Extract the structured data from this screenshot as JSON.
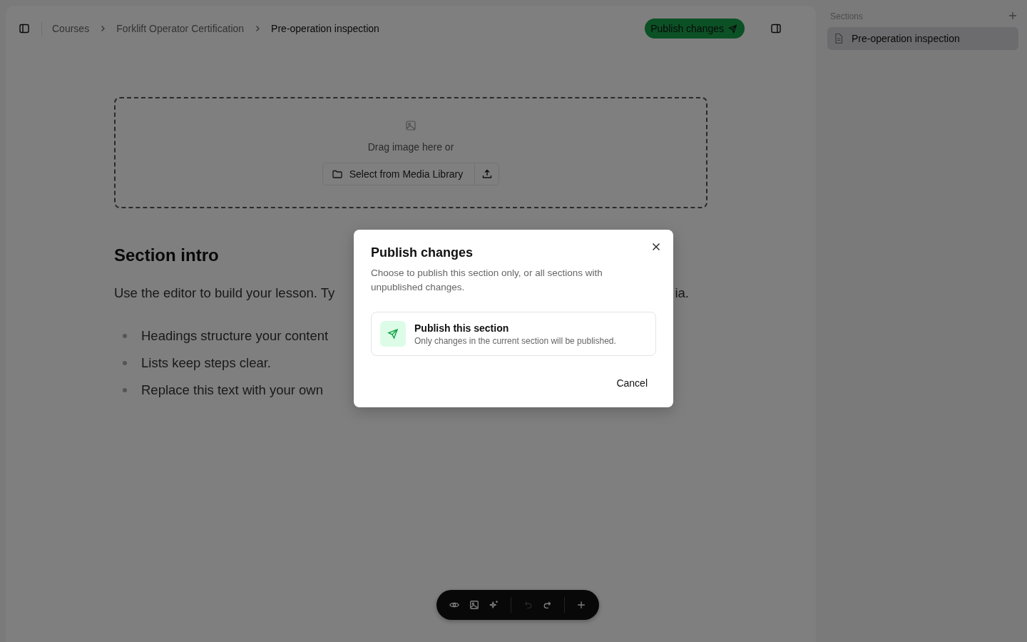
{
  "breadcrumbs": [
    {
      "label": "Courses",
      "current": false
    },
    {
      "label": "Forklift Operator Certification",
      "current": false
    },
    {
      "label": "Pre-operation inspection",
      "current": true
    }
  ],
  "publish_button": "Publish changes",
  "sidebar": {
    "title": "Sections",
    "items": [
      {
        "label": "Pre-operation inspection",
        "selected": true
      }
    ]
  },
  "dropzone": {
    "hint": "Drag image here or",
    "select_button": "Select from Media Library"
  },
  "content": {
    "heading": "Section intro",
    "paragraph_start": "Use the editor to build your lesson. Ty",
    "paragraph_end": "ia.",
    "bullets": [
      "Headings structure your content",
      "Lists keep steps clear.",
      "Replace this text with your own"
    ]
  },
  "toolbar": [
    [
      {
        "kind": "preview",
        "disabled": false
      },
      {
        "kind": "image",
        "disabled": false
      },
      {
        "kind": "magic",
        "disabled": false
      }
    ],
    [
      {
        "kind": "undo",
        "disabled": true
      },
      {
        "kind": "redo",
        "disabled": false
      }
    ],
    [
      {
        "kind": "add",
        "disabled": false
      }
    ]
  ],
  "dialog": {
    "title": "Publish changes",
    "description": "Choose to publish this section only, or all sections with unpublished changes.",
    "options": [
      {
        "title": "Publish this section",
        "description": "Only changes in the current section will be published."
      }
    ],
    "cancel": "Cancel"
  }
}
